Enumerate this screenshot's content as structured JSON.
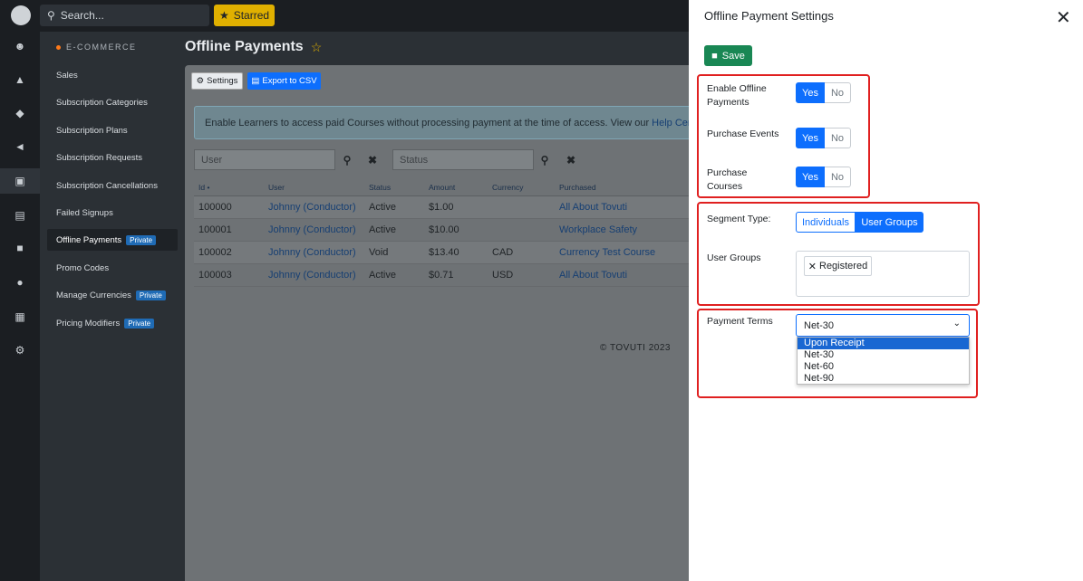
{
  "topbar": {
    "search_placeholder": "Search...",
    "starred_label": "Starred"
  },
  "rail": {
    "icons": [
      "avatar-logo",
      "users-icon",
      "shapes-icon",
      "graduation-cap-icon",
      "megaphone-icon",
      "money-icon",
      "chart-icon",
      "chat-icon",
      "palette-icon",
      "calendar-icon",
      "gear-icon"
    ]
  },
  "sidebar": {
    "section": "E-COMMERCE",
    "items": [
      {
        "label": "Sales"
      },
      {
        "label": "Subscription Categories"
      },
      {
        "label": "Subscription Plans"
      },
      {
        "label": "Subscription Requests"
      },
      {
        "label": "Subscription Cancellations"
      },
      {
        "label": "Failed Signups"
      },
      {
        "label": "Offline Payments",
        "badge": "Private"
      },
      {
        "label": "Promo Codes"
      },
      {
        "label": "Manage Currencies",
        "badge": "Private"
      },
      {
        "label": "Pricing Modifiers",
        "badge": "Private"
      }
    ]
  },
  "main": {
    "title": "Offline Payments",
    "settings_label": "Settings",
    "export_label": "Export to CSV",
    "info_text": "Enable Learners to access paid Courses without processing payment at the time of access. View our",
    "info_link": "Help Center",
    "filters": {
      "user_placeholder": "User",
      "status_placeholder": "Status"
    },
    "table": {
      "headers": [
        "Id •",
        "User",
        "Status",
        "Amount",
        "Currency",
        "Purchased"
      ],
      "rows": [
        [
          "100000",
          "Johnny (Conductor)",
          "Active",
          "$1.00",
          "",
          "All About Tovuti"
        ],
        [
          "100001",
          "Johnny (Conductor)",
          "Active",
          "$10.00",
          "",
          "Workplace Safety"
        ],
        [
          "100002",
          "Johnny (Conductor)",
          "Void",
          "$13.40",
          "CAD",
          "Currency Test Course"
        ],
        [
          "100003",
          "Johnny (Conductor)",
          "Active",
          "$0.71",
          "USD",
          "All About Tovuti"
        ]
      ]
    },
    "footer": "© TOVUTI 2023"
  },
  "panel": {
    "title": "Offline Payment Settings",
    "close": "✕",
    "save_label": "Save",
    "enable_offline": {
      "label": "Enable Offline Payments",
      "yes": "Yes",
      "no": "No",
      "value": "Yes"
    },
    "purchase_events": {
      "label": "Purchase Events",
      "yes": "Yes",
      "no": "No",
      "value": "Yes"
    },
    "purchase_courses": {
      "label": "Purchase Courses",
      "yes": "Yes",
      "no": "No",
      "value": "Yes"
    },
    "segment_type": {
      "label": "Segment Type:",
      "options": [
        "Individuals",
        "User Groups"
      ],
      "selected": "User Groups"
    },
    "user_groups": {
      "label": "User Groups",
      "chips": [
        "Registered"
      ]
    },
    "payment_terms": {
      "label": "Payment Terms",
      "value": "Net-30",
      "options": [
        "Upon Receipt",
        "Net-30",
        "Net-60",
        "Net-90"
      ],
      "highlighted": "Upon Receipt"
    }
  },
  "colors": {
    "primary": "#0d6efd",
    "save": "#198754",
    "starred": "#e0b000",
    "highlight_box": "#e02020"
  }
}
